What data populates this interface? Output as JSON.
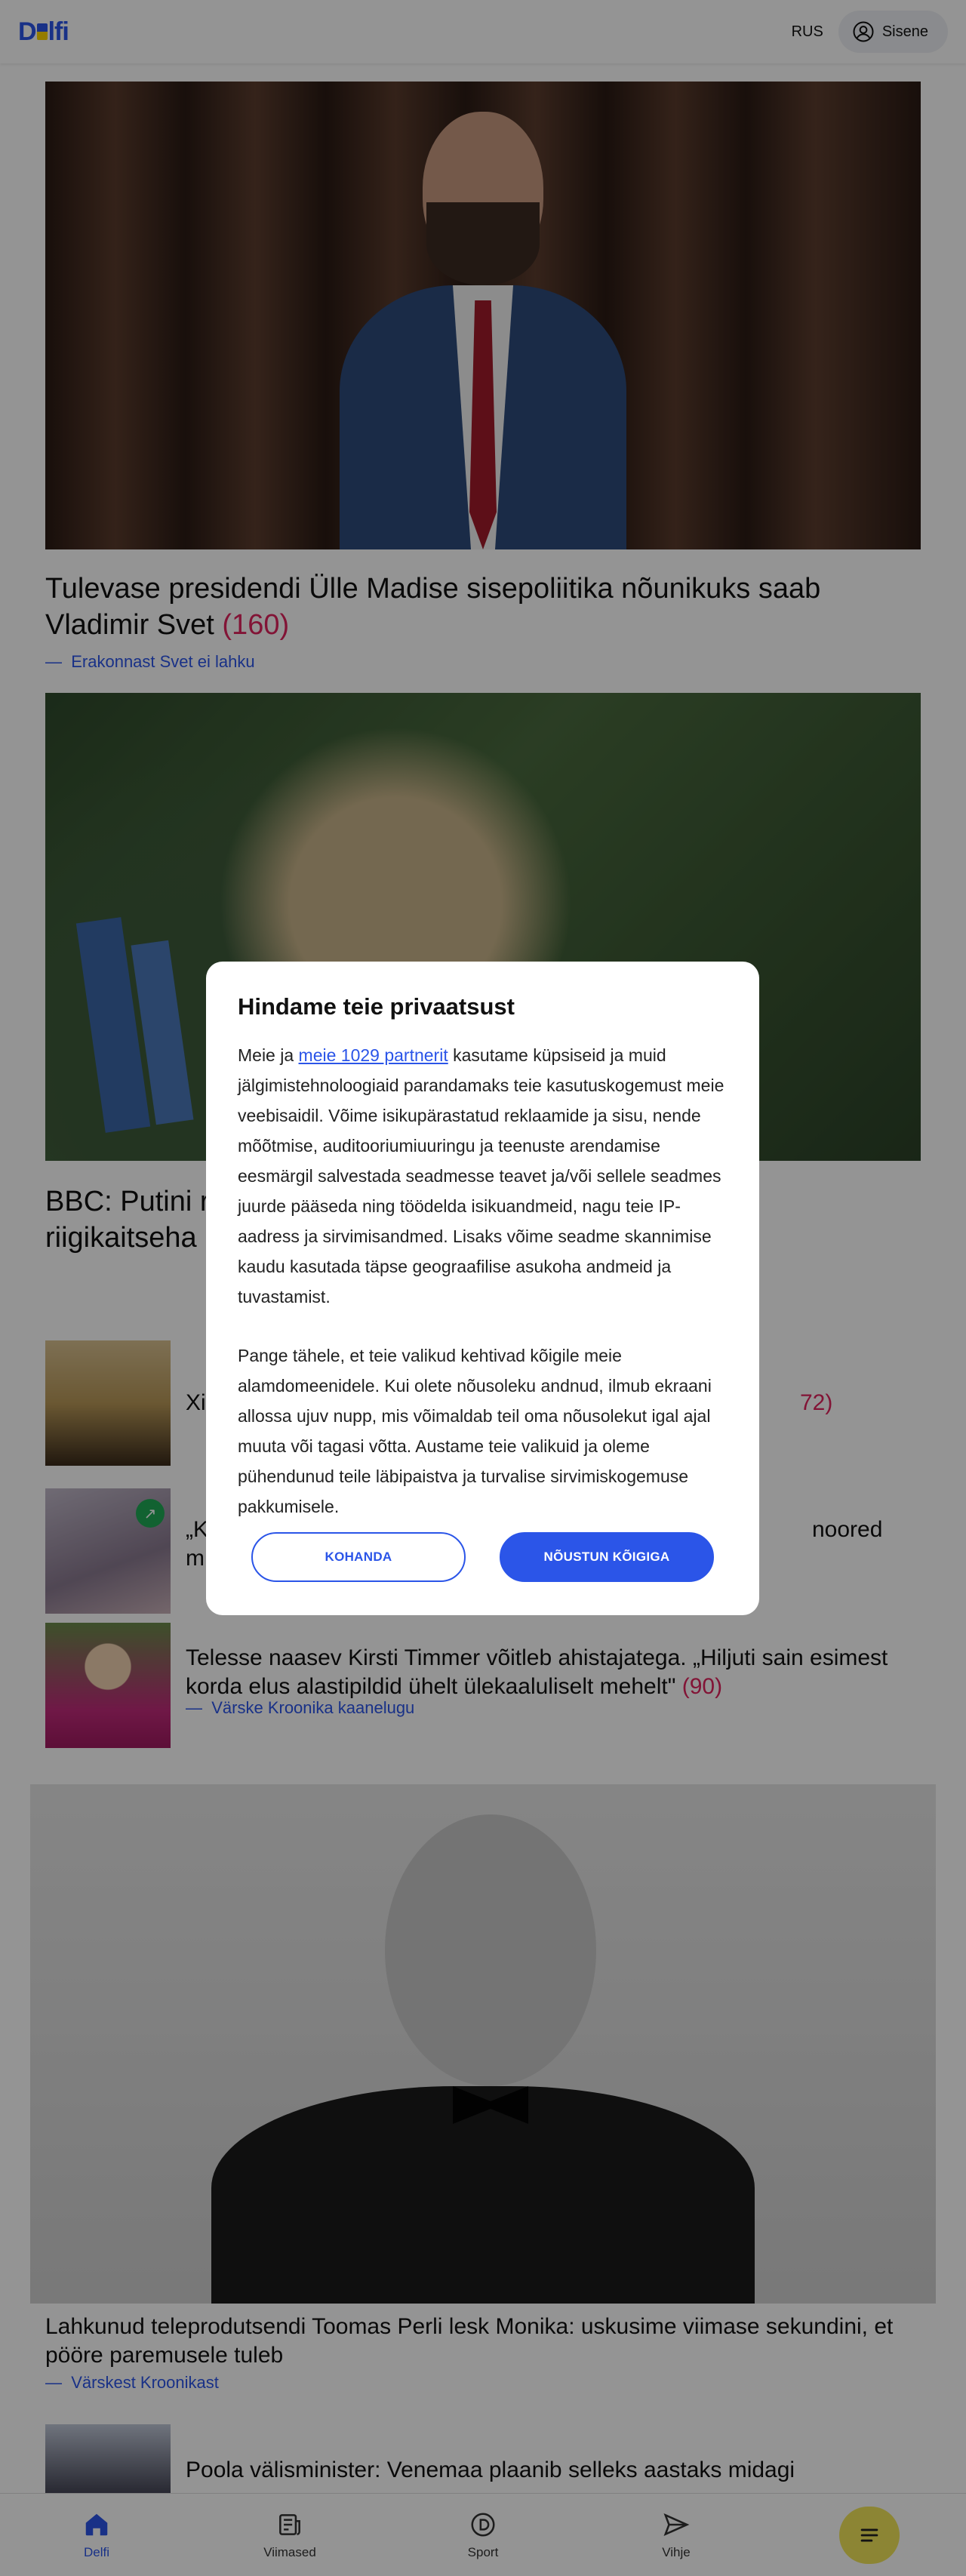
{
  "header": {
    "logo_text_1": "D",
    "logo_text_2": "lfi",
    "lang": "RUS",
    "login": "Sisene"
  },
  "articles": [
    {
      "title": "Tulevase presidendi Ülle Madise sisepoliitika nõunikuks saab Vladimir Svet",
      "count": "(160)",
      "sub": "Erakonnast Svet ei lahku"
    },
    {
      "title_part": "BBC: Putini r",
      "title_part_2": "riigikaitseha"
    },
    {
      "title_part": "Xi",
      "count_part": "72)"
    },
    {
      "title_part": "„K",
      "title_part_2": "m",
      "title_end": "noored"
    },
    {
      "title": "Telesse naasev Kirsti Timmer võitleb ahistajatega. „Hiljuti sain esimest korda elus alastipildid ühelt ülekaaluliselt mehelt\"",
      "count": "(90)",
      "sub": "Värske Kroonika kaanelugu"
    },
    {
      "title": "Lahkunud teleprodutsendi Toomas Perli lesk Monika: uskusime viimase sekundini, et pööre paremusele tuleb",
      "sub": "Värskest Kroonikast"
    },
    {
      "title": "Poola välisminister: Venemaa plaanib selleks aastaks midagi"
    }
  ],
  "dialog": {
    "title": "Hindame teie privaatsust",
    "p1_before": "Meie ja ",
    "p1_link": "meie 1029 partnerit",
    "p1_after": " kasutame küpsiseid ja muid jälgimistehnoloogiaid parandamaks teie kasutuskogemust meie veebisaidil. Võime isikupärastatud reklaamide ja sisu, nende mõõtmise, auditooriumiuuringu ja teenuste arendamise eesmärgil salvestada seadmesse teavet ja/või sellele seadmes juurde pääseda ning töödelda isikuandmeid, nagu teie IP-aadress ja sirvimisandmed. Lisaks võime seadme skannimise kaudu kasutada täpse geograafilise asukoha andmeid ja tuvastamist.",
    "p2": "Pange tähele, et teie valikud kehtivad kõigile meie alamdomeenidele. Kui olete nõusoleku andnud, ilmub ekraani allossa ujuv nupp, mis võimaldab teil oma nõusolekut igal ajal muuta või tagasi võtta. Austame teie valikuid ja oleme pühendunud teile läbipaistva ja turvalise sirvimiskogemuse pakkumisele.",
    "customize": "KOHANDA",
    "accept": "NÕUSTUN KÕIGIGA"
  },
  "nav": {
    "home": "Delfi",
    "latest": "Viimased",
    "sport": "Sport",
    "tip": "Vihje"
  }
}
